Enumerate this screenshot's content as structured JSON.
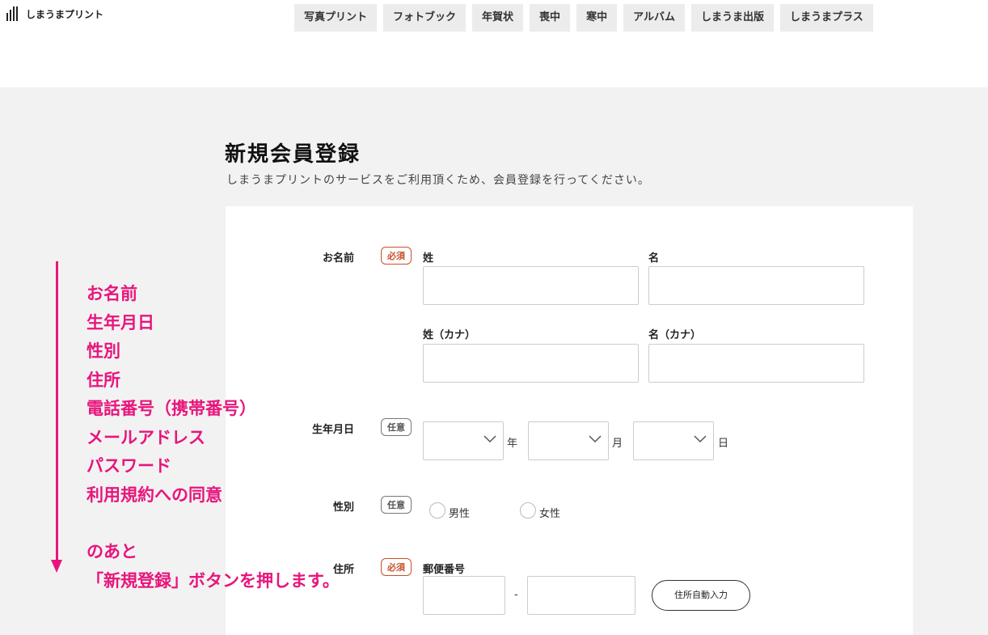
{
  "header": {
    "logo_text": "しまうまプリント",
    "nav": [
      "写真プリント",
      "フォトブック",
      "年賀状",
      "喪中",
      "寒中",
      "アルバム",
      "しまうま出版",
      "しまうまプラス"
    ]
  },
  "page": {
    "title": "新規会員登録",
    "subtitle": "しまうまプリントのサービスをご利用頂くため、会員登録を行ってください。"
  },
  "form": {
    "required_badge": "必須",
    "optional_badge": "任意",
    "name": {
      "label": "お名前",
      "sei": "姓",
      "mei": "名",
      "sei_kana": "姓（カナ）",
      "mei_kana": "名（カナ）"
    },
    "birthday": {
      "label": "生年月日",
      "year_unit": "年",
      "month_unit": "月",
      "day_unit": "日"
    },
    "gender": {
      "label": "性別",
      "male": "男性",
      "female": "女性"
    },
    "address": {
      "label": "住所",
      "postal_label": "郵便番号",
      "dash": "-",
      "auto_button": "住所自動入力"
    }
  },
  "annotation": {
    "lines": [
      "お名前",
      "生年月日",
      "性別",
      "住所",
      "電話番号（携帯番号）",
      "メールアドレス",
      "パスワード",
      "利用規約への同意"
    ],
    "after_lines": [
      "のあと",
      "「新規登録」ボタンを押します。"
    ],
    "color": "#e8157c"
  }
}
